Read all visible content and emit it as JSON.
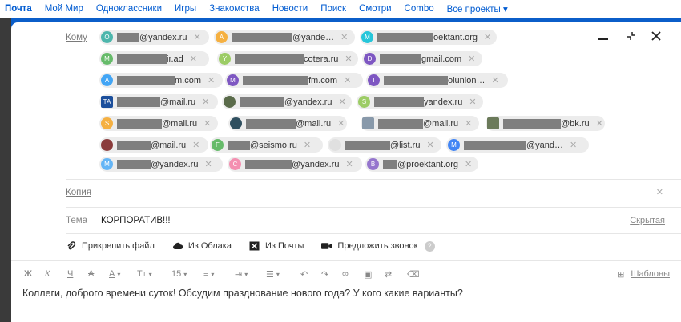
{
  "topnav": [
    "Почта",
    "Мой Мир",
    "Одноклассники",
    "Игры",
    "Знакомства",
    "Новости",
    "Поиск",
    "Смотри",
    "Combo",
    "Все проекты ▾"
  ],
  "fields": {
    "to_label": "Кому",
    "cc_label": "Копия",
    "subject_label": "Тема",
    "hide_label": "Скрытая"
  },
  "subject": "КОРПОРАТИВ!!!",
  "recipients": [
    {
      "initial": "O",
      "color": "#4db6ac",
      "email": "@yandex.ru"
    },
    {
      "initial": "A",
      "color": "#f5b041",
      "email": "@yande…"
    },
    {
      "initial": "M",
      "color": "#26c6da",
      "email": "oektant.org"
    },
    {
      "initial": "M",
      "color": "#66bb6a",
      "email": "ir.ad"
    },
    {
      "initial": "Y",
      "color": "#9ccc65",
      "email": "cotera.ru"
    },
    {
      "initial": "D",
      "color": "#7e57c2",
      "email": "gmail.com"
    },
    {
      "initial": "A",
      "color": "#42a5f5",
      "email": "m.com"
    },
    {
      "initial": "M",
      "color": "#7e57c2",
      "email": "fm.com"
    },
    {
      "initial": "T",
      "color": "#7e57c2",
      "email": "olunion…"
    },
    {
      "initial": "TA",
      "color": "#1c4f9c",
      "email": "@mail.ru"
    },
    {
      "initial": "",
      "color": "#5a6b4a",
      "email": "@yandex.ru"
    },
    {
      "initial": "S",
      "color": "#9ccc65",
      "email": "yandex.ru"
    },
    {
      "initial": "S",
      "color": "#f5b041",
      "email": "@mail.ru"
    },
    {
      "initial": "",
      "color": "#2f4f5f",
      "email": "@mail.ru"
    },
    {
      "initial": "",
      "color": "#8899aa",
      "email": "@mail.ru"
    },
    {
      "initial": "",
      "color": "#6b7a5a",
      "email": "@bk.ru"
    },
    {
      "initial": "",
      "color": "#8a3b3b",
      "email": "@mail.ru"
    },
    {
      "initial": "F",
      "color": "#66bb6a",
      "email": "@seismo.ru"
    },
    {
      "initial": "",
      "color": "#e0e0e0",
      "email": "@list.ru"
    },
    {
      "initial": "M",
      "color": "#4285f4",
      "email": "@yand…"
    },
    {
      "initial": "M",
      "color": "#64b5f6",
      "email": "@yandex.ru"
    },
    {
      "initial": "C",
      "color": "#f48fb1",
      "email": "@yandex.ru"
    },
    {
      "initial": "B",
      "color": "#9575cd",
      "email": "@proektant.org"
    }
  ],
  "attachments": [
    "Прикрепить файл",
    "Из Облака",
    "Из Почты",
    "Предложить звонок"
  ],
  "toolbar": {
    "bold": "Ж",
    "italic": "К",
    "underline": "Ч",
    "strike": "А",
    "font_size": "15",
    "templates": "Шаблоны"
  },
  "message": "Коллеги, доброго времени суток! Обсудим празднование нового года? У кого какие варианты?"
}
